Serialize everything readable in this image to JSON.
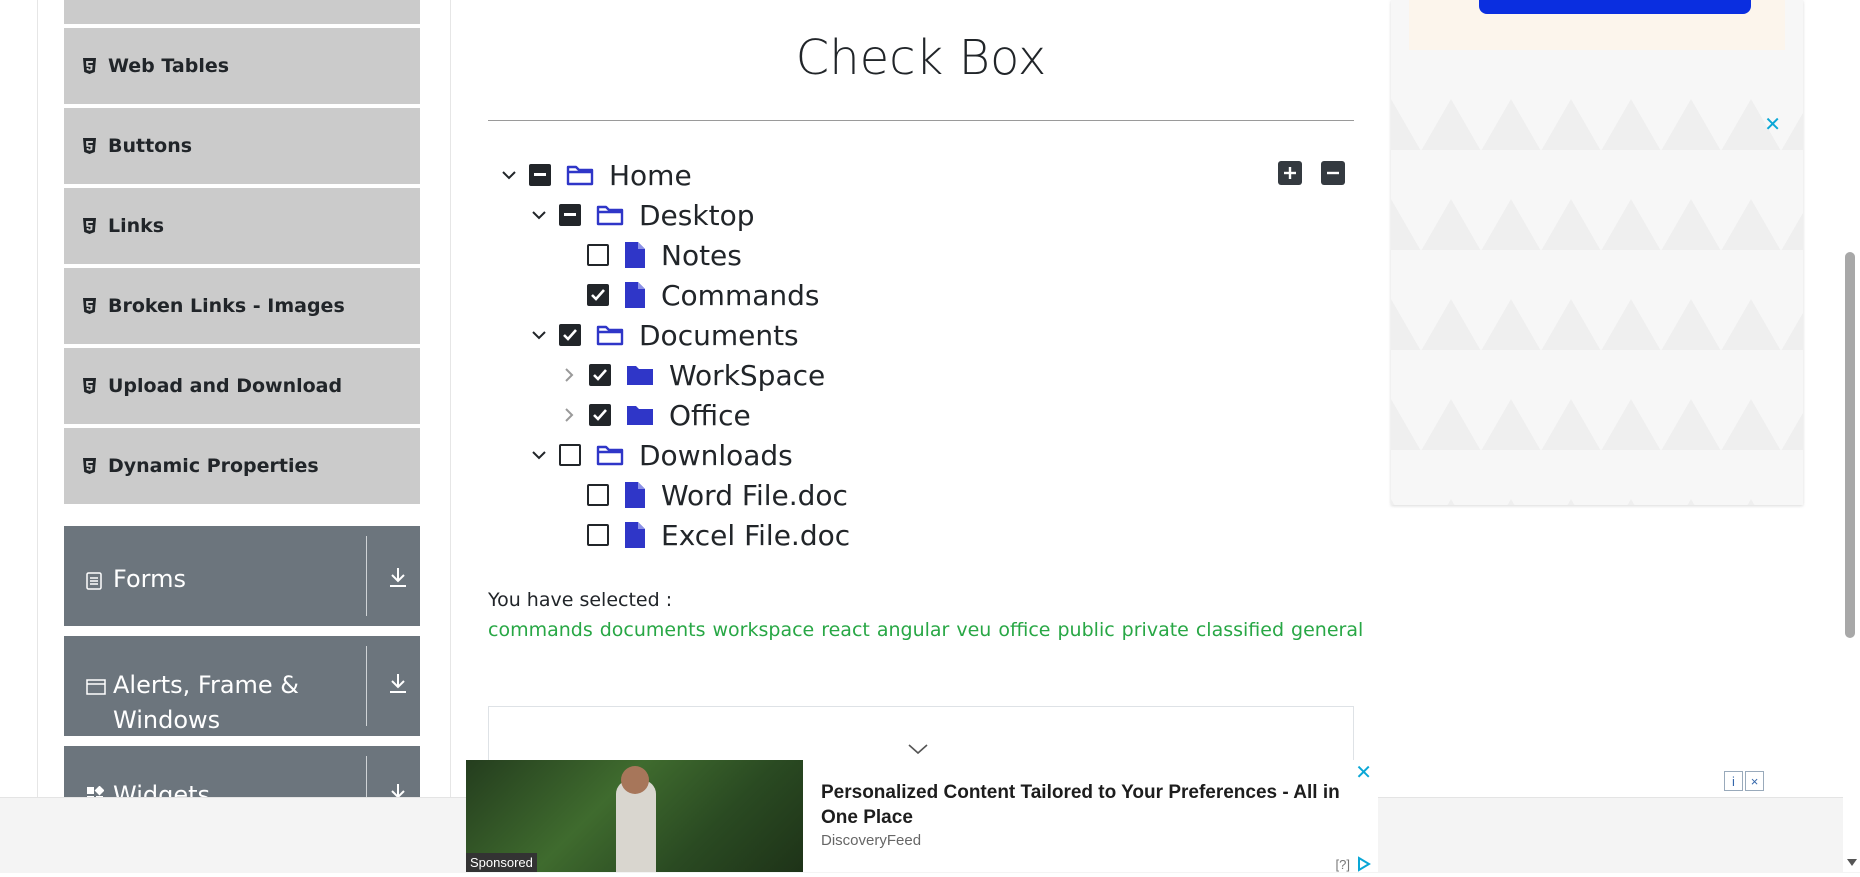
{
  "sidebar": {
    "items": [
      {
        "label": "Web Tables"
      },
      {
        "label": "Buttons"
      },
      {
        "label": "Links"
      },
      {
        "label": "Broken Links - Images"
      },
      {
        "label": "Upload and Download"
      },
      {
        "label": "Dynamic Properties"
      }
    ],
    "groups": [
      {
        "label": "Forms"
      },
      {
        "label": "Alerts, Frame & Windows"
      },
      {
        "label": "Widgets"
      }
    ]
  },
  "page": {
    "title": "Check Box"
  },
  "tree": {
    "nodes": [
      {
        "label": "Home",
        "state": "half",
        "type": "folder",
        "expanded": true
      },
      {
        "label": "Desktop",
        "state": "half",
        "type": "folder",
        "expanded": true
      },
      {
        "label": "Notes",
        "state": "unchecked",
        "type": "file"
      },
      {
        "label": "Commands",
        "state": "checked",
        "type": "file"
      },
      {
        "label": "Documents",
        "state": "checked",
        "type": "folder",
        "expanded": true
      },
      {
        "label": "WorkSpace",
        "state": "checked",
        "type": "folder",
        "expanded": false
      },
      {
        "label": "Office",
        "state": "checked",
        "type": "folder",
        "expanded": false
      },
      {
        "label": "Downloads",
        "state": "unchecked",
        "type": "folder",
        "expanded": true
      },
      {
        "label": "Word File.doc",
        "state": "unchecked",
        "type": "file"
      },
      {
        "label": "Excel File.doc",
        "state": "unchecked",
        "type": "file"
      }
    ]
  },
  "result": {
    "prefix": "You have selected :",
    "items": [
      "commands",
      "documents",
      "workspace",
      "react",
      "angular",
      "veu",
      "office",
      "public",
      "private",
      "classified",
      "general"
    ]
  },
  "ads": {
    "bottom": {
      "headline": "Personalized Content Tailored to Your Preferences - All in One Place",
      "source": "DiscoveryFeed",
      "sponsored": "Sponsored",
      "help": "[?]",
      "close": "✕"
    },
    "right_close": "✕"
  },
  "colors": {
    "menu_item_bg": "#cbcbcb",
    "group_bg": "#6c757d",
    "folder_icon": "#2f36c8",
    "selected_text": "#28a745",
    "checkbox": "#212529"
  }
}
